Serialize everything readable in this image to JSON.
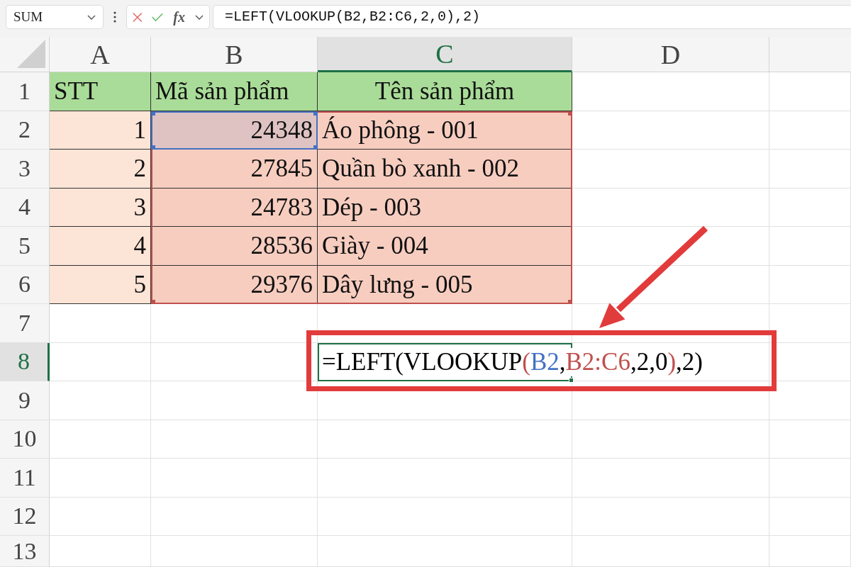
{
  "formula_bar": {
    "name_box": "SUM",
    "insert_function": "fx",
    "formula": "=LEFT(VLOOKUP(B2,B2:C6,2,0),2)"
  },
  "grid": {
    "columns": [
      {
        "label": "A",
        "selected": false
      },
      {
        "label": "B",
        "selected": false
      },
      {
        "label": "C",
        "selected": true
      },
      {
        "label": "D",
        "selected": false
      }
    ],
    "rows": [
      {
        "label": "1",
        "selected": false,
        "cells": [
          {
            "text": "STT",
            "kind": "text",
            "color": "#a9dc98"
          },
          {
            "text": "Mã sản phẩm",
            "kind": "text",
            "color": "#a9dc98"
          },
          {
            "text": "Tên sản phẩm",
            "kind": "title",
            "color": "#a9dc98"
          }
        ]
      },
      {
        "label": "2",
        "selected": false,
        "cells": [
          {
            "text": "1",
            "kind": "number",
            "color": "#fce4d6"
          },
          {
            "text": "24348",
            "kind": "number",
            "color": "#dfc3c3"
          },
          {
            "text": "Áo phông - 001",
            "kind": "text",
            "color": "#f7cdbf"
          }
        ]
      },
      {
        "label": "3",
        "selected": false,
        "cells": [
          {
            "text": "2",
            "kind": "number",
            "color": "#fce4d6"
          },
          {
            "text": "27845",
            "kind": "number",
            "color": "#f7cdbf"
          },
          {
            "text": "Quần bò xanh - 002",
            "kind": "text",
            "color": "#f7cdbf"
          }
        ]
      },
      {
        "label": "4",
        "selected": false,
        "cells": [
          {
            "text": "3",
            "kind": "number",
            "color": "#fce4d6"
          },
          {
            "text": "24783",
            "kind": "number",
            "color": "#f7cdbf"
          },
          {
            "text": "Dép - 003",
            "kind": "text",
            "color": "#f7cdbf"
          }
        ]
      },
      {
        "label": "5",
        "selected": false,
        "cells": [
          {
            "text": "4",
            "kind": "number",
            "color": "#fce4d6"
          },
          {
            "text": "28536",
            "kind": "number",
            "color": "#f7cdbf"
          },
          {
            "text": "Giày - 004",
            "kind": "text",
            "color": "#f7cdbf"
          }
        ]
      },
      {
        "label": "6",
        "selected": false,
        "cells": [
          {
            "text": "5",
            "kind": "number",
            "color": "#fce4d6"
          },
          {
            "text": "29376",
            "kind": "number",
            "color": "#f7cdbf"
          },
          {
            "text": "Dây lưng - 005",
            "kind": "text",
            "color": "#f7cdbf"
          }
        ]
      },
      {
        "label": "7",
        "selected": false
      },
      {
        "label": "8",
        "selected": true,
        "editor": {
          "tokens": [
            {
              "text": "=LEFT(VLOOKUP",
              "kind": "plain",
              "color": "#000000"
            },
            {
              "text": "(",
              "kind": "plain",
              "color": "#c0504d"
            },
            {
              "text": "B2",
              "kind": "reference",
              "color": "#4472c4"
            },
            {
              "text": ",",
              "kind": "plain",
              "color": "#000000"
            },
            {
              "text": "B2:C6",
              "kind": "reference",
              "color": "#c0504d"
            },
            {
              "text": ",2,0",
              "kind": "plain",
              "color": "#000000"
            },
            {
              "text": ")",
              "kind": "plain",
              "color": "#c0504d"
            },
            {
              "text": ",2)",
              "kind": "plain",
              "color": "#000000"
            }
          ]
        }
      },
      {
        "label": "9",
        "selected": false
      },
      {
        "label": "10",
        "selected": false
      },
      {
        "label": "11",
        "selected": false
      },
      {
        "label": "12",
        "selected": false
      },
      {
        "label": "13",
        "selected": false
      }
    ]
  }
}
